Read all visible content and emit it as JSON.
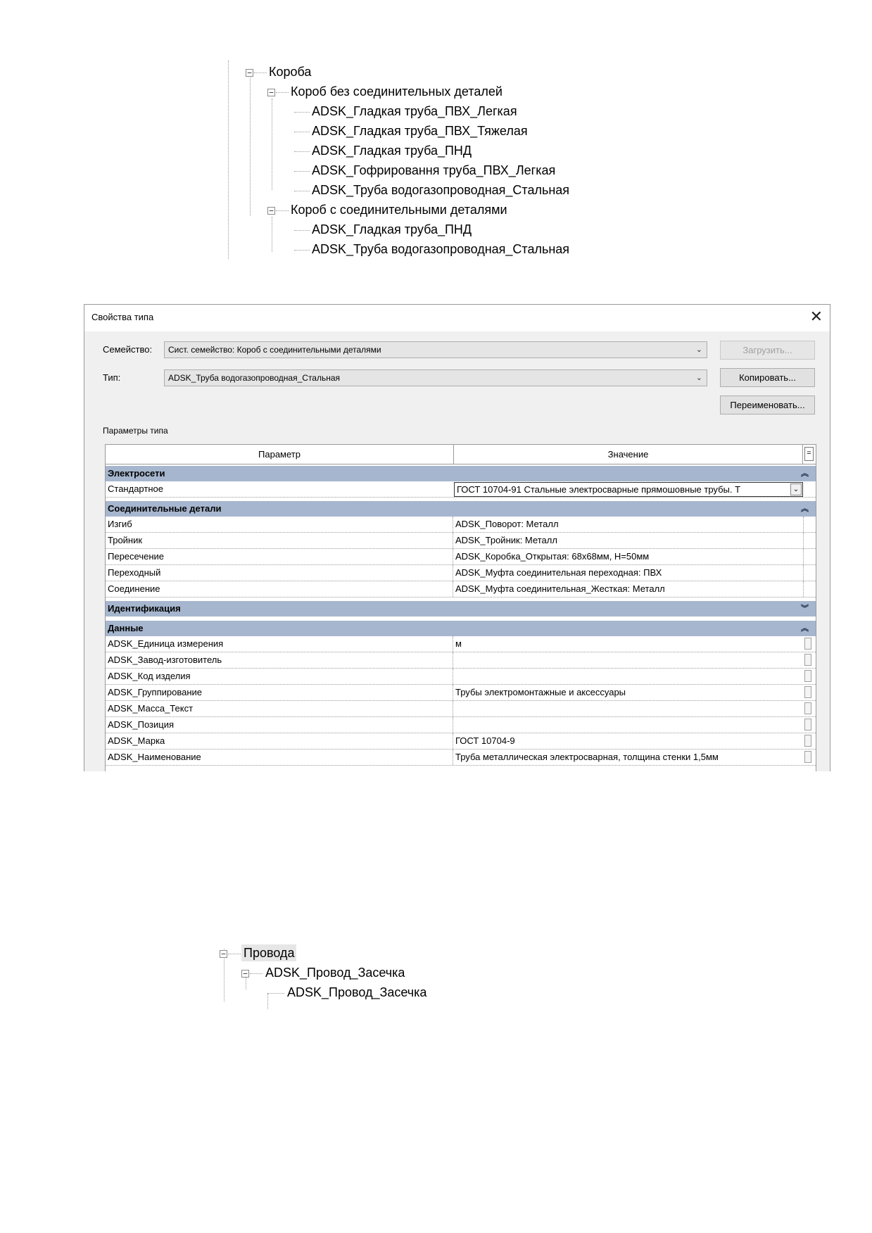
{
  "tree_korob": {
    "root": "Короба",
    "group1": "Короб без соединительных деталей",
    "group1_items": [
      "ADSK_Гладкая труба_ПВХ_Легкая",
      "ADSK_Гладкая труба_ПВХ_Тяжелая",
      "ADSK_Гладкая труба_ПНД",
      "ADSK_Гофрировання труба_ПВХ_Легкая",
      "ADSK_Труба водогазопроводная_Стальная"
    ],
    "group2": "Короб с соединительными деталями",
    "group2_items": [
      "ADSK_Гладкая труба_ПНД",
      "ADSK_Труба водогазопроводная_Стальная"
    ]
  },
  "dialog": {
    "title": "Свойства типа",
    "family_label": "Семейство:",
    "family_value": "Сист. семейство: Короб с соединительными деталями",
    "type_label": "Тип:",
    "type_value": "ADSK_Труба водогазопроводная_Стальная",
    "load_button": "Загрузить...",
    "copy_button": "Копировать...",
    "rename_button": "Переименовать...",
    "params_caption": "Параметры типа",
    "col_param": "Параметр",
    "col_value": "Значение",
    "col_btn": "=",
    "groups": {
      "electro": "Электросети",
      "fittings": "Соединительные детали",
      "ident": "Идентификация",
      "data": "Данные"
    },
    "electro_rows": [
      {
        "param": "Стандартное",
        "value": "ГОСТ 10704-91 Стальные электросварные прямошовные трубы. Т"
      }
    ],
    "fittings_rows": [
      {
        "param": "Изгиб",
        "value": "ADSK_Поворот: Металл"
      },
      {
        "param": "Тройник",
        "value": "ADSK_Тройник: Металл"
      },
      {
        "param": "Пересечение",
        "value": "ADSK_Коробка_Открытая: 68х68мм, Н=50мм"
      },
      {
        "param": "Переходный",
        "value": "ADSK_Муфта соединительная переходная: ПВХ"
      },
      {
        "param": "Соединение",
        "value": "ADSK_Муфта соединительная_Жесткая: Металл"
      }
    ],
    "data_rows": [
      {
        "param": "ADSK_Единица измерения",
        "value": "м"
      },
      {
        "param": "ADSK_Завод-изготовитель",
        "value": ""
      },
      {
        "param": "ADSK_Код изделия",
        "value": ""
      },
      {
        "param": "ADSK_Группирование",
        "value": "Трубы электромонтажные и аксессуары"
      },
      {
        "param": "ADSK_Масса_Текст",
        "value": ""
      },
      {
        "param": "ADSK_Позиция",
        "value": ""
      },
      {
        "param": "ADSK_Марка",
        "value": "ГОСТ 10704-9"
      },
      {
        "param": "ADSK_Наименование",
        "value": "Труба металлическая электросварная, толщина стенки 1,5мм"
      }
    ]
  },
  "tree_provoda": {
    "root": "Провода",
    "group1": "ADSK_Провод_Засечка",
    "item1": "ADSK_Провод_Засечка"
  },
  "icons": {
    "minus": "⊟",
    "chevron_down": "⌄",
    "collapse_up": "⌃",
    "expand_down": "⌄",
    "close": "✕"
  }
}
